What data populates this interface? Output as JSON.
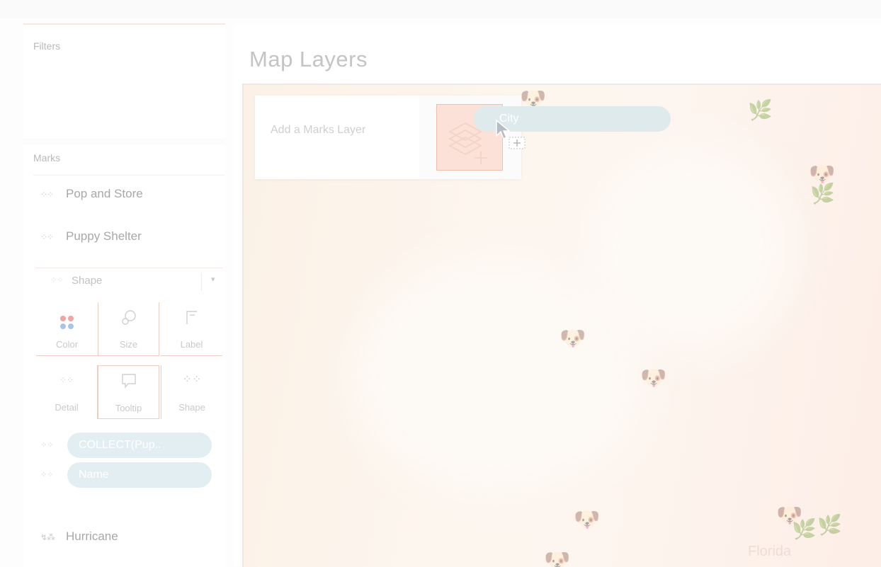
{
  "sidebar": {
    "filters_title": "Filters",
    "marks_title": "Marks",
    "layers": [
      {
        "label": "Pop and Store",
        "icon": "dot-grid-icon"
      },
      {
        "label": "Puppy Shelter",
        "icon": "dot-grid-icon"
      },
      {
        "label": "Hurricane",
        "icon": "hurricane-icon"
      }
    ],
    "mark_type": {
      "label": "Shape",
      "icon": "shape-icon"
    },
    "cards": {
      "color": "Color",
      "size": "Size",
      "label": "Label",
      "detail": "Detail",
      "tooltip": "Tooltip",
      "shape": "Shape"
    },
    "color_dots": [
      "#f0a4a4",
      "#f0a4a4",
      "#a9c4ea",
      "#a9c4ea"
    ],
    "fields": [
      {
        "label": "COLLECT(Pup..",
        "icon": "detail-icon"
      },
      {
        "label": "Name",
        "icon": "detail-icon"
      }
    ]
  },
  "main": {
    "title": "Map Layers",
    "add_layer_label": "Add a Marks Layer",
    "dragged_field": "City",
    "map_label": "Florida"
  },
  "colors": {
    "pill_bg": "#e3eef2",
    "accent": "#f0bfae",
    "dropzone_bg": "#fbe1d8"
  }
}
